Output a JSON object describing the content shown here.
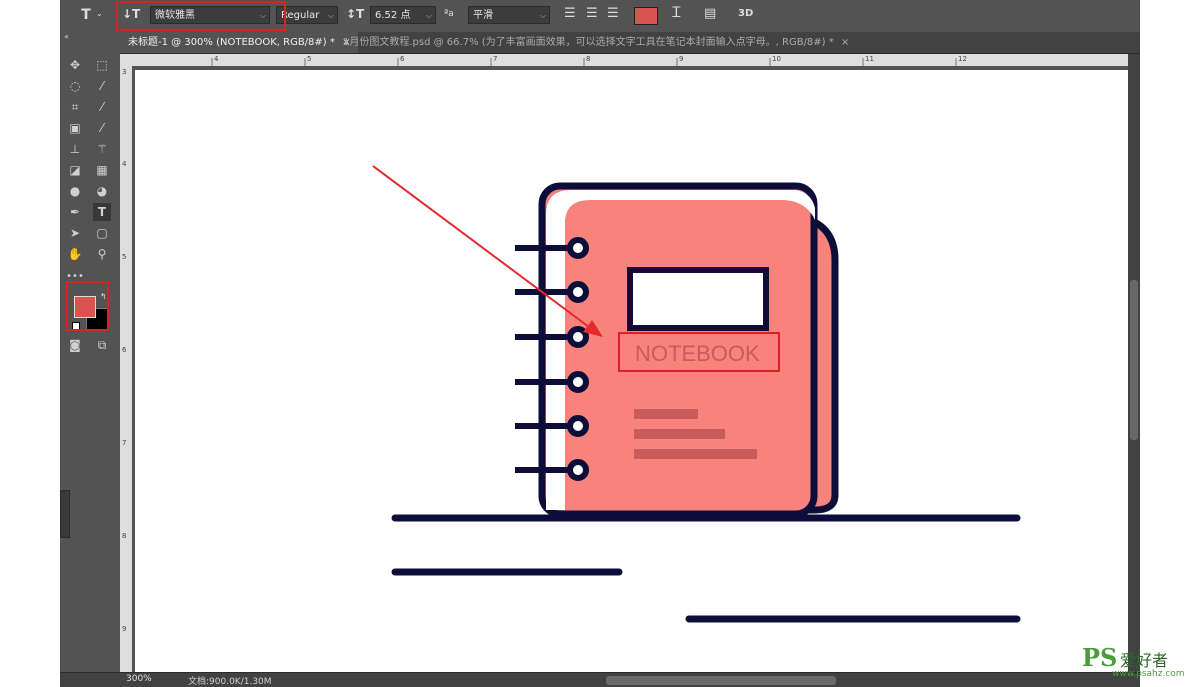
{
  "options_bar": {
    "tool_glyph": "T",
    "font_family": "微软雅黑",
    "font_style": "Regular",
    "font_size": "6.52 点",
    "aa_label": "ªa",
    "antialias": "平滑",
    "text_color": "#d9534f",
    "three_d_label": "3D"
  },
  "tabs": [
    {
      "label": "未标题-1 @ 300% (NOTEBOOK, RGB/8#) *",
      "active": true
    },
    {
      "label": "1月份图文教程.psd @ 66.7% (为了丰富画面效果，可以选择文字工具在笔记本封面输入点字母。, RGB/8#) *",
      "active": false
    }
  ],
  "ruler_top_numbers": [
    "4",
    "5",
    "6",
    "7",
    "8",
    "9",
    "10",
    "11",
    "12"
  ],
  "ruler_left_numbers": [
    "3",
    "4",
    "5",
    "6",
    "7",
    "8",
    "9"
  ],
  "canvas": {
    "notebook_text": "NOTEBOOK",
    "cover_color": "#f8827c",
    "outline_color": "#0d0d3a"
  },
  "status": {
    "zoom": "300%",
    "doc_size": "文档:900.0K/1.30M"
  },
  "watermark": {
    "ps": "PS",
    "cn": "爱好者",
    "url": "www.psahz.com"
  },
  "colors": {
    "foreground": "#d9534f",
    "background": "#000000",
    "highlight": "#e02020"
  }
}
